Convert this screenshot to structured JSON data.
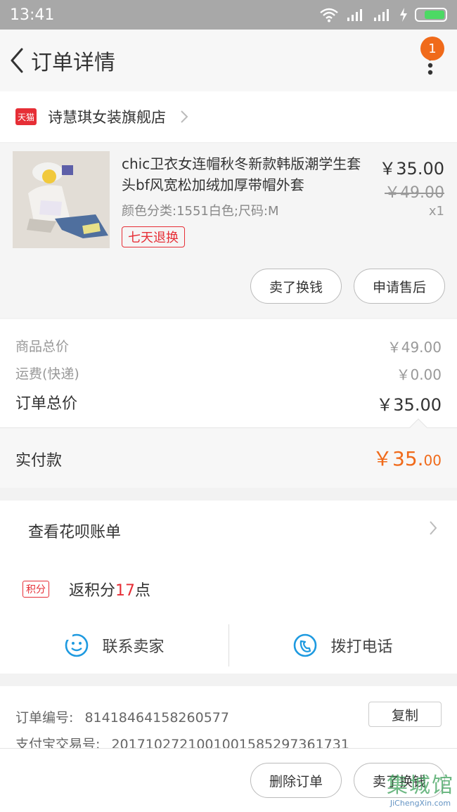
{
  "status_bar": {
    "time": "13:41"
  },
  "nav": {
    "title": "订单详情",
    "badge_count": "1"
  },
  "store": {
    "platform_tag": "天猫",
    "name": "诗慧琪女装旗舰店"
  },
  "product": {
    "title": "chic卫衣女连帽秋冬新款韩版潮学生套头bf风宽松加绒加厚带帽外套",
    "attributes": "颜色分类:1551白色;尺码:M",
    "return_tag": "七天退换",
    "price": "￥35.00",
    "original_price": "￥49.00",
    "quantity": "x1",
    "actions": {
      "resell_label": "卖了换钱",
      "after_sales_label": "申请售后"
    }
  },
  "summary": {
    "goods_total_label": "商品总价",
    "goods_total_value": "￥49.00",
    "shipping_label": "运费(快递)",
    "shipping_value": "￥0.00",
    "order_total_label": "订单总价",
    "order_total_value": "￥35.00",
    "paid_label": "实付款",
    "paid_value_main": "￥35.",
    "paid_value_cents": "00"
  },
  "huabei": {
    "label": "查看花呗账单"
  },
  "points": {
    "tag": "积分",
    "prefix": "返积分",
    "number": "17",
    "suffix": "点"
  },
  "contact": {
    "seller_label": "联系卖家",
    "phone_label": "拨打电话"
  },
  "order_info": {
    "order_no_label": "订单编号:",
    "order_no": "81418464158260577",
    "copy_label": "复制",
    "alipay_label": "支付宝交易号:",
    "alipay_no": "2017102721001001585297361731"
  },
  "bottom_bar": {
    "delete_label": "删除订单",
    "resell_label": "卖了换钱"
  },
  "watermark": {
    "main": "集城馆",
    "sub": "JiChengXin.com"
  },
  "colors": {
    "accent_orange": "#f06a1a",
    "tmall_red": "#e62e36",
    "status_bar": "#a8a8a8"
  }
}
